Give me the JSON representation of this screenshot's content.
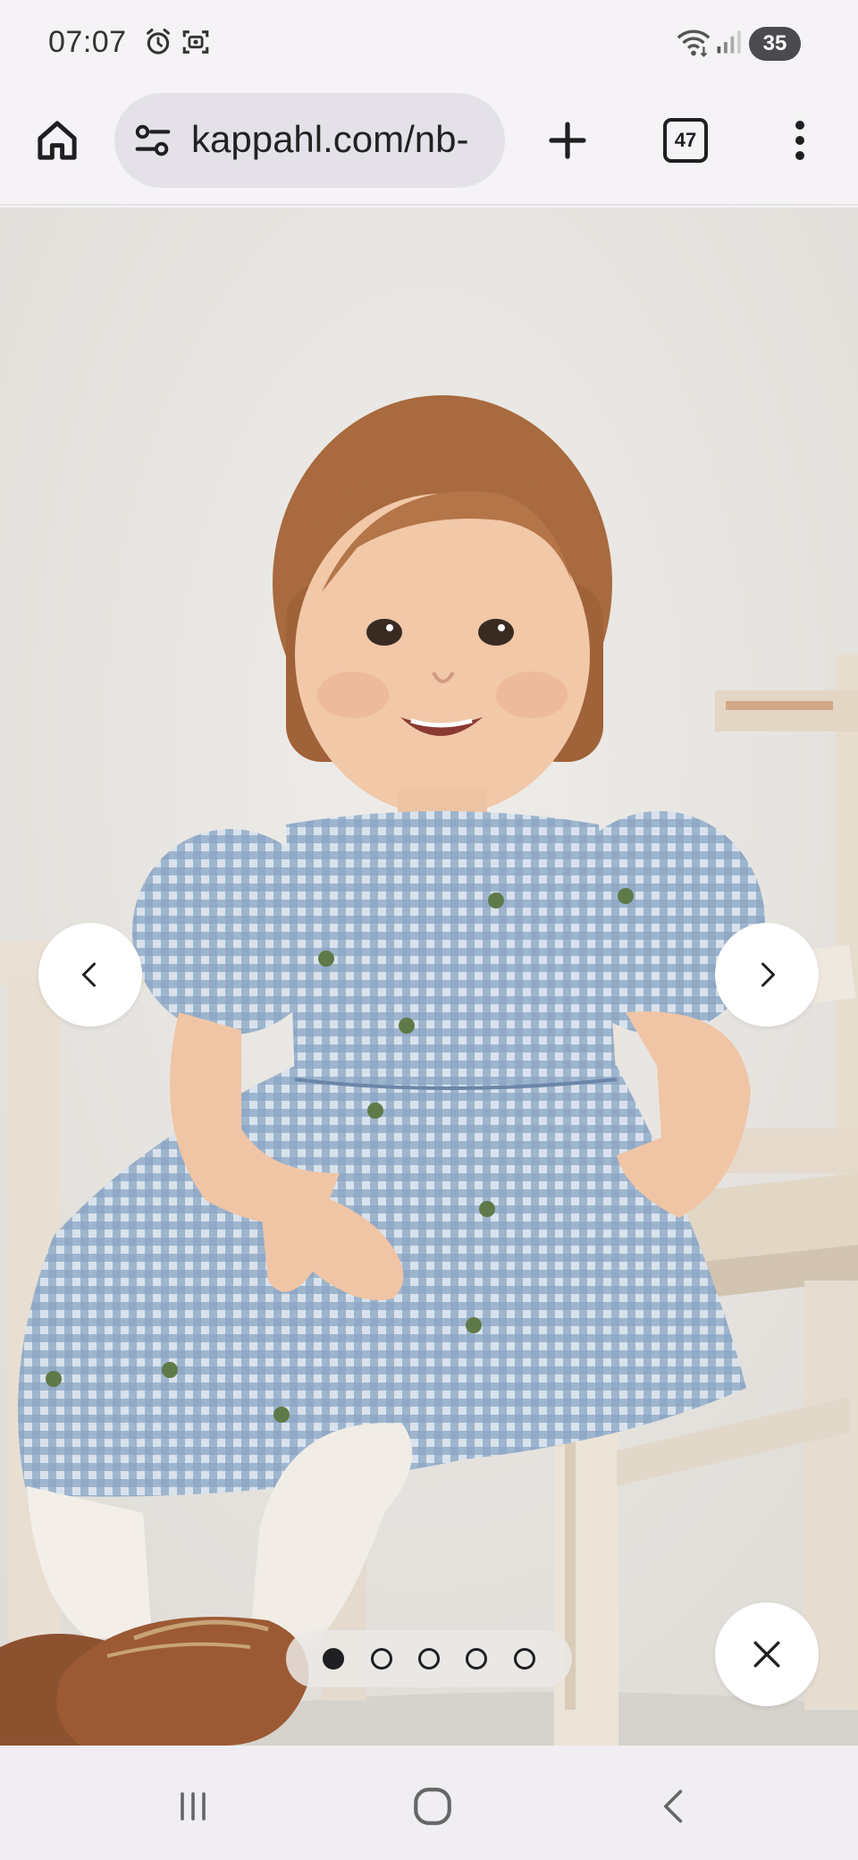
{
  "status_bar": {
    "time": "07:07",
    "battery": "35",
    "icons": [
      "alarm-icon",
      "face-scan-icon",
      "wifi-icon",
      "signal-icon"
    ]
  },
  "browser": {
    "url": "kappahl.com/nb-",
    "tab_count": "47",
    "icons": [
      "home-icon",
      "site-settings-icon",
      "plus-icon",
      "tabs-icon",
      "more-vert-icon"
    ]
  },
  "gallery": {
    "slides_total": 5,
    "active_slide": 1,
    "controls": [
      "chevron-left-icon",
      "chevron-right-icon",
      "close-icon"
    ]
  },
  "system_nav": {
    "icons": [
      "recents-icon",
      "home-circle-icon",
      "back-icon"
    ]
  },
  "colors": {
    "background": "#f5f3f6",
    "pill": "#e4e2e8",
    "dress_blue": "#7f9bbd",
    "wall": "#e9e7e3"
  }
}
